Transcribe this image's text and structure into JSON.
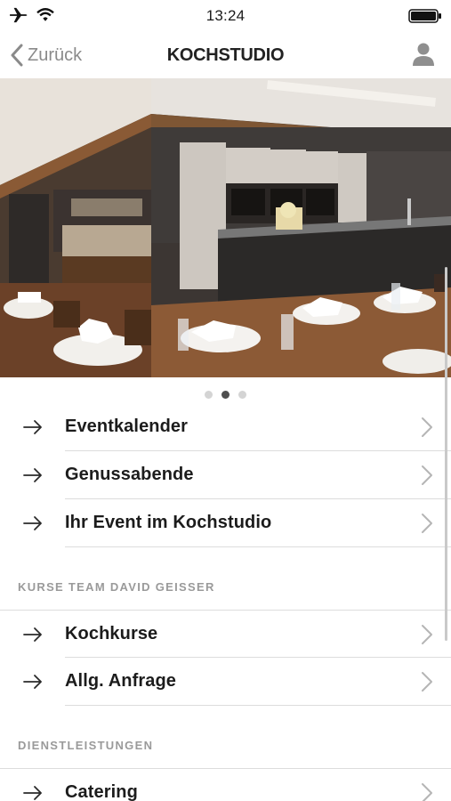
{
  "status_bar": {
    "time": "13:24"
  },
  "nav": {
    "back_label": "Zurück",
    "title": "KOCHSTUDIO"
  },
  "pager": {
    "count": 3,
    "active_index": 1
  },
  "menu": {
    "group1": [
      {
        "label": "Eventkalender"
      },
      {
        "label": "Genussabende"
      },
      {
        "label": "Ihr Event im Kochstudio"
      }
    ],
    "section2_title": "KURSE TEAM DAVID GEISSER",
    "group2": [
      {
        "label": "Kochkurse"
      },
      {
        "label": "Allg. Anfrage"
      }
    ],
    "section3_title": "DIENSTLEISTUNGEN",
    "group3": [
      {
        "label": "Catering"
      }
    ]
  }
}
